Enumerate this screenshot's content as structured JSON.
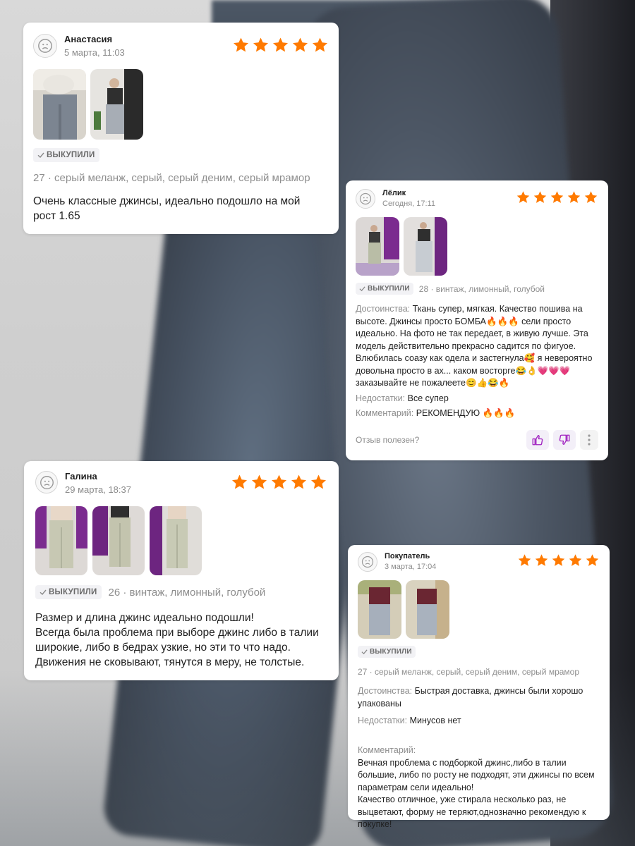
{
  "accent": {
    "star": "#ff7a00",
    "badge_bg": "#f2f2f5",
    "icon_purple": "#a020c0"
  },
  "reviews": [
    {
      "name": "Анастасия",
      "date": "5 марта, 11:03",
      "rating": 5,
      "badge": "ВЫКУПИЛИ",
      "variant": "27 · серый меланж, серый, серый деним, серый мрамор",
      "body": "Очень классные джинсы, идеально подошло на мой рост 1.65"
    },
    {
      "name": "Лёлик",
      "date": "Сегодня, 17:11",
      "rating": 5,
      "badge": "ВЫКУПИЛИ",
      "variant": "28 · винтаж, лимонный, голубой",
      "pros_label": "Достоинства:",
      "pros": "Ткань супер, мягкая. Качество пошива на высоте. Джинсы просто БОМБА🔥🔥🔥 сели просто идеально. На фото не так передает, в живую лучше. Эта модель действительно прекрасно садится по фигуое. Влюбилась соазу как одела и застегнула🥰 я невероятно довольна просто в ах... каком восторге😂👌💗💗💗 заказывайте не пожалеете😊👍😂🔥",
      "cons_label": "Недостатки:",
      "cons": "Все супер",
      "comment_label": "Комментарий:",
      "comment": "РЕКОМЕНДУЮ 🔥🔥🔥",
      "helpful": "Отзыв полезен?"
    },
    {
      "name": "Галина",
      "date": "29 марта, 18:37",
      "rating": 5,
      "badge": "ВЫКУПИЛИ",
      "variant": "26 · винтаж, лимонный, голубой",
      "body": "Размер и длина джинс идеально подошли!\nВсегда была проблема при выборе джинс либо в талии широкие, либо в бедрах узкие, но эти то что надо.\nДвижения не сковывают, тянутся в меру, не толстые."
    },
    {
      "name": "Покупатель",
      "date": "3 марта, 17:04",
      "rating": 5,
      "badge": "ВЫКУПИЛИ",
      "variant": "27 · серый меланж, серый, серый деним, серый мрамор",
      "pros_label": "Достоинства:",
      "pros": "Быстрая доставка, джинсы были хорошо упакованы",
      "cons_label": "Недостатки:",
      "cons": "Минусов нет",
      "comment_label": "Комментарий:",
      "comment": "Вечная проблема с подборкой джинс,либо в талии большие, либо по росту не подходят, эти джинсы по всем параметрам сели идеально!\nКачество отличное, уже стирала несколько раз, не выцветают, форму не теряют,однозначно рекомендую к покупке!"
    }
  ]
}
